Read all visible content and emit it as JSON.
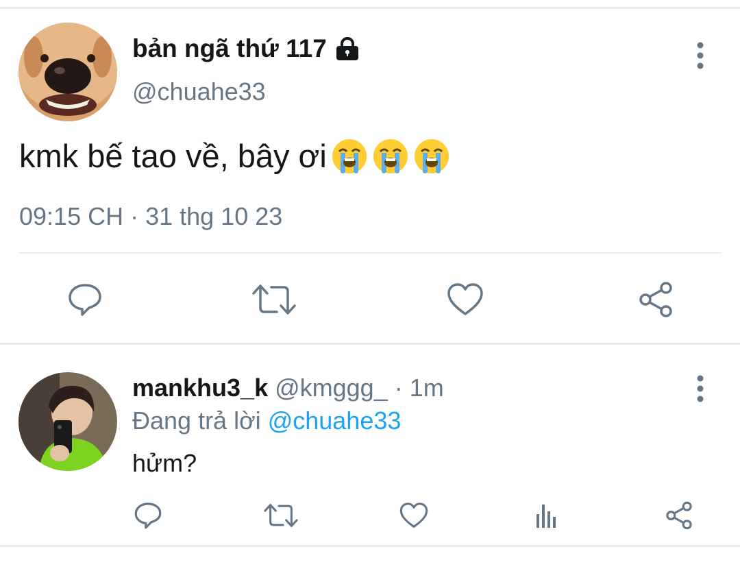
{
  "main_tweet": {
    "display_name": "bản ngã thứ 117",
    "handle": "@chuahe33",
    "text": "kmk bế tao về, bây ơi",
    "emojis": [
      "loudly-crying-face",
      "loudly-crying-face",
      "loudly-crying-face"
    ],
    "timestamp": "09:15 CH · 31 thg 10 23",
    "protected": true
  },
  "reply_tweet": {
    "display_name": "mankhu3_k",
    "meta": " @kmggg_ · 1m",
    "replying_prefix": "Đang trả lời ",
    "replying_to": "@chuahe33",
    "text": "hửm?"
  },
  "colors": {
    "text": "#14171a",
    "secondary": "#657786",
    "accent": "#1da1f2",
    "divider": "#e6ecf0"
  },
  "icons": {
    "main_actions": [
      "reply-icon",
      "retweet-icon",
      "like-icon",
      "share-icon"
    ],
    "reply_actions": [
      "reply-icon",
      "retweet-icon",
      "like-icon",
      "analytics-icon",
      "share-icon"
    ]
  }
}
